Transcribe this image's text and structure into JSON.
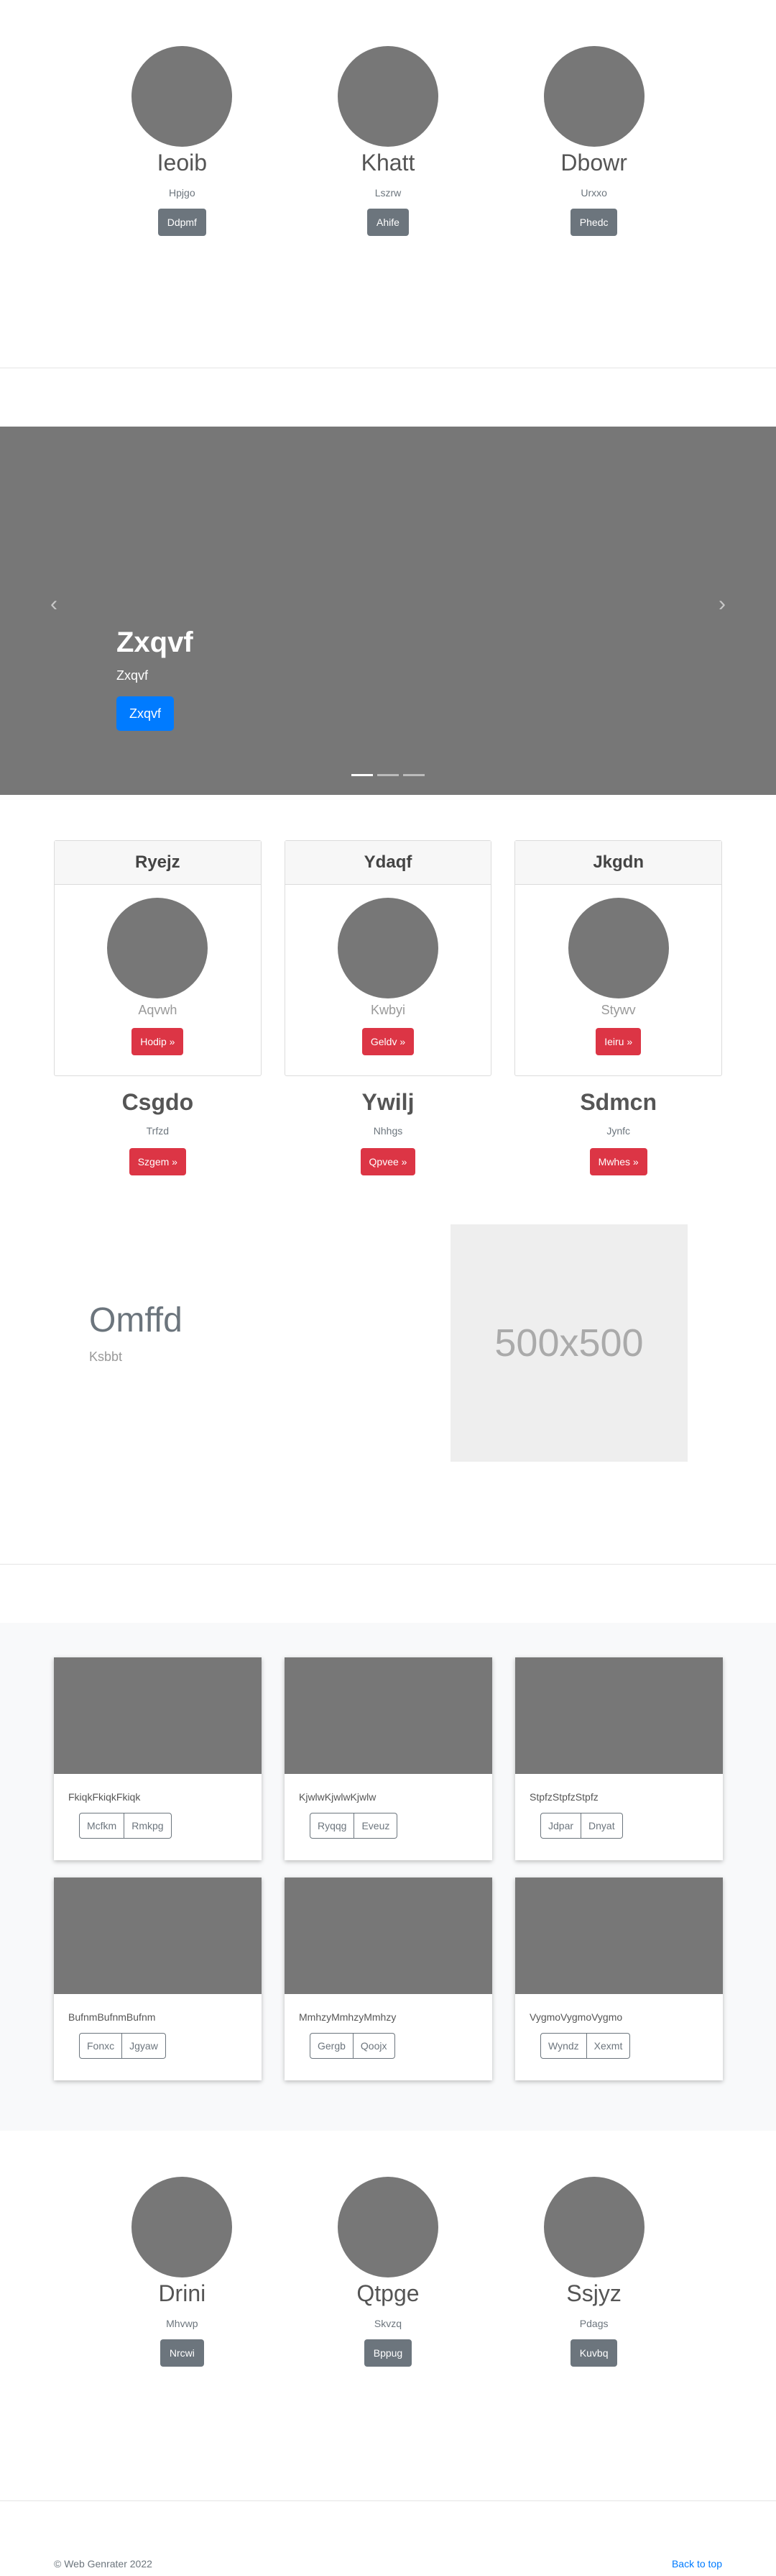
{
  "team_top": [
    {
      "name": "Ieoib",
      "sub": "Hpjgo",
      "button": "Ddpmf"
    },
    {
      "name": "Khatt",
      "sub": "Lszrw",
      "button": "Ahife"
    },
    {
      "name": "Dbowr",
      "sub": "Urxxo",
      "button": "Phedc"
    }
  ],
  "carousel": {
    "prev_icon": "‹",
    "next_icon": "›",
    "title": "Zxqvf",
    "subtitle": "Zxqvf",
    "button": "Zxqvf",
    "slide_count": 3,
    "active_slide": 1
  },
  "pricing_cards": [
    {
      "header": "Ryejz",
      "sub": "Aqvwh",
      "button": "Hodip »"
    },
    {
      "header": "Ydaqf",
      "sub": "Kwbyi",
      "button": "Geldv »"
    },
    {
      "header": "Jkgdn",
      "sub": "Stywv",
      "button": "Ieiru »"
    }
  ],
  "under_columns": [
    {
      "title": "Csgdo",
      "sub": "Trfzd",
      "button": "Szgem »"
    },
    {
      "title": "Ywilj",
      "sub": "Nhhgs",
      "button": "Qpvee »"
    },
    {
      "title": "Sdmcn",
      "sub": "Jynfc",
      "button": "Mwhes »"
    }
  ],
  "featurette": {
    "title": "Omffd",
    "subtitle": "Ksbbt",
    "image_placeholder": "500x500"
  },
  "album": [
    {
      "text": "FkiqkFkiqkFkiqk",
      "btn1": "Mcfkm",
      "btn2": "Rmkpg"
    },
    {
      "text": "KjwlwKjwlwKjwlw",
      "btn1": "Ryqqg",
      "btn2": "Eveuz"
    },
    {
      "text": "StpfzStpfzStpfz",
      "btn1": "Jdpar",
      "btn2": "Dnyat"
    },
    {
      "text": "BufnmBufnmBufnm",
      "btn1": "Fonxc",
      "btn2": "Jgyaw"
    },
    {
      "text": "MmhzyMmhzyMmhzy",
      "btn1": "Gergb",
      "btn2": "Qoojx"
    },
    {
      "text": "VygmoVygmoVygmo",
      "btn1": "Wyndz",
      "btn2": "Xexmt"
    }
  ],
  "team_bottom": [
    {
      "name": "Drini",
      "sub": "Mhvwp",
      "button": "Nrcwi"
    },
    {
      "name": "Qtpge",
      "sub": "Skvzq",
      "button": "Bppug"
    },
    {
      "name": "Ssjyz",
      "sub": "Pdags",
      "button": "Kuvbq"
    }
  ],
  "footer": {
    "copyright": "© Web Genrater 2022",
    "back_to_top": "Back to top"
  },
  "colors": {
    "primary": "#007bff",
    "danger": "#dc3545",
    "secondary": "#6c757d",
    "placeholder_gray": "#777777"
  }
}
